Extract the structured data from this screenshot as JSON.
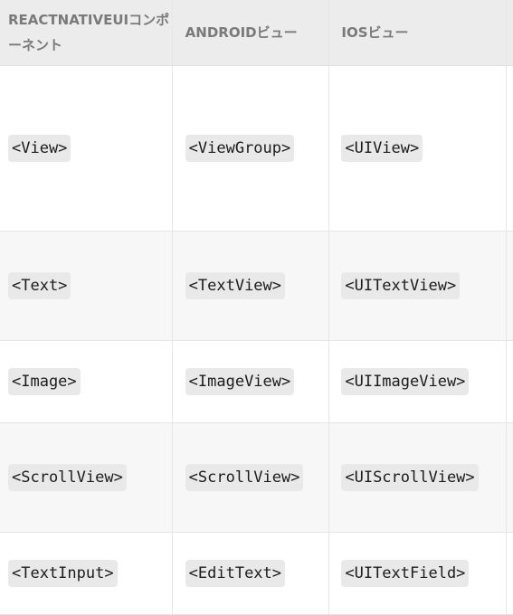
{
  "headers": [
    "REACTNATIVEUIコンポーネント",
    "ANDROIDビュー",
    "IOSビュー"
  ],
  "rows": [
    [
      "<View>",
      "<ViewGroup>",
      "<UIView>"
    ],
    [
      "<Text>",
      "<TextView>",
      "<UITextView>"
    ],
    [
      "<Image>",
      "<ImageView>",
      "<UIImageView>"
    ],
    [
      "<ScrollView>",
      "<ScrollView>",
      "<UIScrollView>"
    ],
    [
      "<TextInput>",
      "<EditText>",
      "<UITextField>"
    ]
  ]
}
